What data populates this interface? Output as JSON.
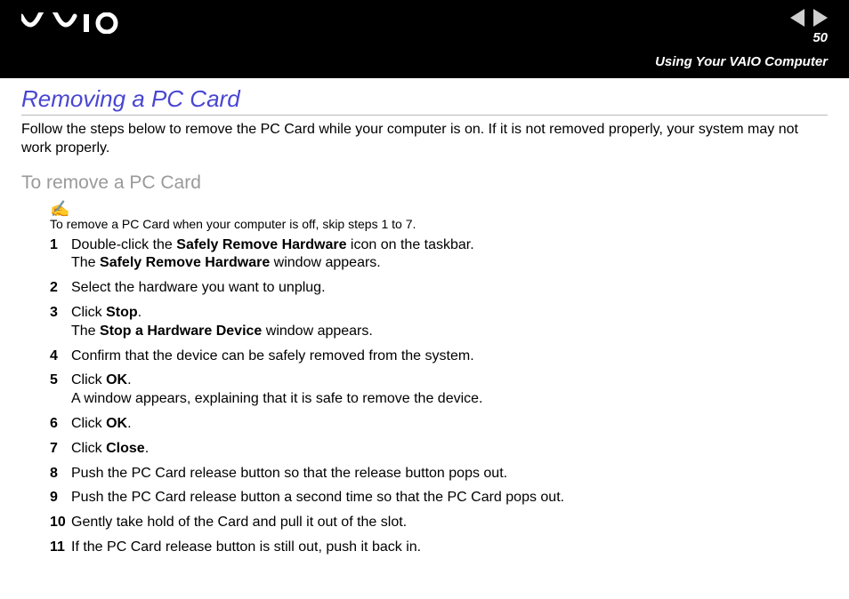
{
  "header": {
    "page_number": "50",
    "section": "Using Your VAIO Computer"
  },
  "title": "Removing a PC Card",
  "intro": "Follow the steps below to remove the PC Card while your computer is on. If it is not removed properly, your system may not work properly.",
  "subtitle": "To remove a PC Card",
  "note": {
    "icon": "✍",
    "text": "To remove a PC Card when your computer is off, skip steps 1 to 7."
  },
  "steps": [
    {
      "num": "1",
      "parts": [
        {
          "t": "Double-click the "
        },
        {
          "t": "Safely Remove Hardware",
          "b": true
        },
        {
          "t": " icon on the taskbar."
        },
        {
          "br": true
        },
        {
          "t": "The "
        },
        {
          "t": "Safely Remove Hardware",
          "b": true
        },
        {
          "t": " window appears."
        }
      ]
    },
    {
      "num": "2",
      "parts": [
        {
          "t": "Select the hardware you want to unplug."
        }
      ]
    },
    {
      "num": "3",
      "parts": [
        {
          "t": "Click "
        },
        {
          "t": "Stop",
          "b": true
        },
        {
          "t": "."
        },
        {
          "br": true
        },
        {
          "t": "The "
        },
        {
          "t": "Stop a Hardware Device",
          "b": true
        },
        {
          "t": " window appears."
        }
      ]
    },
    {
      "num": "4",
      "parts": [
        {
          "t": "Confirm that the device can be safely removed from the system."
        }
      ]
    },
    {
      "num": "5",
      "parts": [
        {
          "t": "Click "
        },
        {
          "t": "OK",
          "b": true
        },
        {
          "t": "."
        },
        {
          "br": true
        },
        {
          "t": "A window appears, explaining that it is safe to remove the device."
        }
      ]
    },
    {
      "num": "6",
      "parts": [
        {
          "t": "Click "
        },
        {
          "t": "OK",
          "b": true
        },
        {
          "t": "."
        }
      ]
    },
    {
      "num": "7",
      "parts": [
        {
          "t": "Click "
        },
        {
          "t": "Close",
          "b": true
        },
        {
          "t": "."
        }
      ]
    },
    {
      "num": "8",
      "parts": [
        {
          "t": "Push the PC Card release button so that the release button pops out."
        }
      ]
    },
    {
      "num": "9",
      "parts": [
        {
          "t": "Push the PC Card release button a second time so that the PC Card pops out."
        }
      ]
    },
    {
      "num": "10",
      "parts": [
        {
          "t": "Gently take hold of the Card and pull it out of the slot."
        }
      ]
    },
    {
      "num": "11",
      "parts": [
        {
          "t": "If the PC Card release button is still out, push it back in."
        }
      ]
    }
  ]
}
